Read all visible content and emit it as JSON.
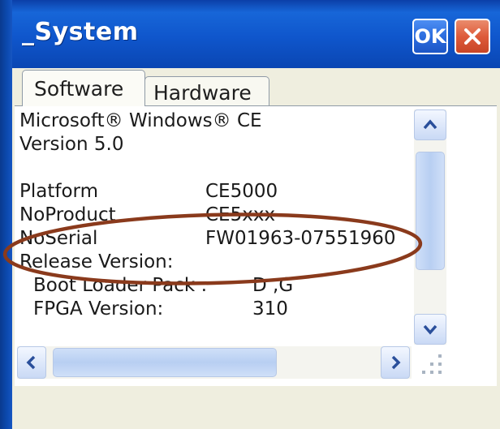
{
  "window": {
    "title": "_System",
    "ok_label": "OK"
  },
  "tabs": [
    {
      "label": "Software",
      "selected": true
    },
    {
      "label": "Hardware",
      "selected": false
    }
  ],
  "info": {
    "line1": "Microsoft® Windows® CE",
    "line2": "Version 5.0",
    "rows": [
      {
        "label": "Platform",
        "value": "CE5000"
      },
      {
        "label": "NoProduct",
        "value": "CE5xxx"
      },
      {
        "label": "NoSerial",
        "value": "FW01963-07551960"
      }
    ],
    "release_label": "Release Version:",
    "sub_rows": [
      {
        "label": "Boot Loader Pack :",
        "value": "D ,G"
      },
      {
        "label": "FPGA Version:",
        "value": "310"
      }
    ]
  },
  "annotation": {
    "color": "#8a3a1c"
  },
  "icons": [
    "chevron-up-icon",
    "chevron-down-icon",
    "chevron-left-icon",
    "chevron-right-icon",
    "close-icon",
    "resize-grip-icon"
  ]
}
